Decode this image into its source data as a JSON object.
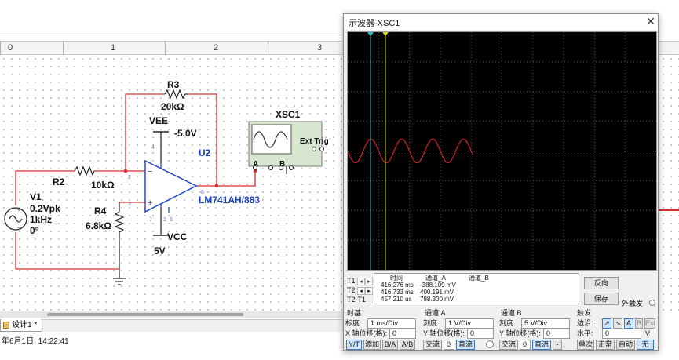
{
  "ruler": {
    "labels": [
      "0",
      "1",
      "2",
      "3"
    ]
  },
  "components": {
    "r3": {
      "name": "R3",
      "value": "20kΩ"
    },
    "r2": {
      "name": "R2",
      "value": "10kΩ"
    },
    "r4": {
      "name": "R4",
      "value": "6.8kΩ"
    },
    "v1": {
      "name": "V1",
      "amplitude": "0.2Vpk",
      "frequency": "1kHz",
      "phase": "0°"
    },
    "vee": {
      "name": "VEE",
      "value": "-5.0V"
    },
    "vcc": {
      "name": "VCC",
      "value": "5V"
    },
    "u2": {
      "name": "U2",
      "part": "LM741AH/883"
    },
    "xsc1": {
      "name": "XSC1",
      "ext_trig": "Ext Trig",
      "ch_a": "A",
      "ch_b": "B"
    },
    "opamp_pins": {
      "p2": "2",
      "p3": "3",
      "p4": "4",
      "p6": "6",
      "p7": "7",
      "p1": "1",
      "p5": "5"
    }
  },
  "tabs": {
    "design_tab": "设计1 *"
  },
  "status": {
    "text": "年6月1日, 14:22:41"
  },
  "scope": {
    "title": "示波器-XSC1",
    "close_glyph": "✕",
    "readout": {
      "headers": {
        "time": "时间",
        "channel_a": "通道_A",
        "channel_b": "通道_B"
      },
      "rows": [
        {
          "label": "T1",
          "time": "416.276 ms",
          "channel_a": "-388.109 mV",
          "channel_b": ""
        },
        {
          "label": "T2",
          "time": "416.733 ms",
          "channel_a": "400.191 mV",
          "channel_b": ""
        },
        {
          "label": "T2-T1",
          "time": "457.210 us",
          "channel_a": "788.300 mV",
          "channel_b": ""
        }
      ],
      "arrow_left": "◂",
      "arrow_right": "▸"
    },
    "buttons": {
      "reverse": "反向",
      "save": "保存",
      "ext_trigger": "外触发"
    },
    "timebase": {
      "title": "时基",
      "scale_label": "标度:",
      "scale_value": "1 ms/Div",
      "xpos_label": "X 轴位移(格):",
      "xpos_value": "0",
      "mode_yt": "Y/T",
      "mode_add": "添加",
      "mode_ba": "B/A",
      "mode_ab": "A/B"
    },
    "channel_a": {
      "title": "通道 A",
      "scale_label": "刻度:",
      "scale_value": "1  V/Div",
      "ypos_label": "Y 轴位移(格):",
      "ypos_value": "0",
      "coupling_ac": "交流",
      "coupling_zero": "0",
      "coupling_dc": "直流"
    },
    "channel_b": {
      "title": "通道 B",
      "scale_label": "刻度:",
      "scale_value": "5  V/Div",
      "ypos_label": "Y 轴位移(格):",
      "ypos_value": "0",
      "coupling_ac": "交流",
      "coupling_zero": "0",
      "coupling_dc": "直流",
      "coupling_minus": "-"
    },
    "trigger": {
      "title": "触发",
      "edge_label": "边沿:",
      "edge_rise": "↗",
      "edge_fall": "↘",
      "src_a": "A",
      "src_b": "B",
      "src_ext": "Ext",
      "level_label": "水平:",
      "level_value": "0",
      "level_unit": "V",
      "mode_single": "单次",
      "mode_normal": "正常",
      "mode_auto": "自动",
      "mode_none": "无"
    },
    "trace": {
      "color": "#c0202a",
      "amplitude_div": 0.4,
      "period_div": 1.0,
      "start_div": 0.0,
      "end_div": 4.05,
      "phase": "negative-start"
    },
    "cursor_colors": {
      "t1": "#29c0c8",
      "t2": "#d8d820"
    }
  }
}
